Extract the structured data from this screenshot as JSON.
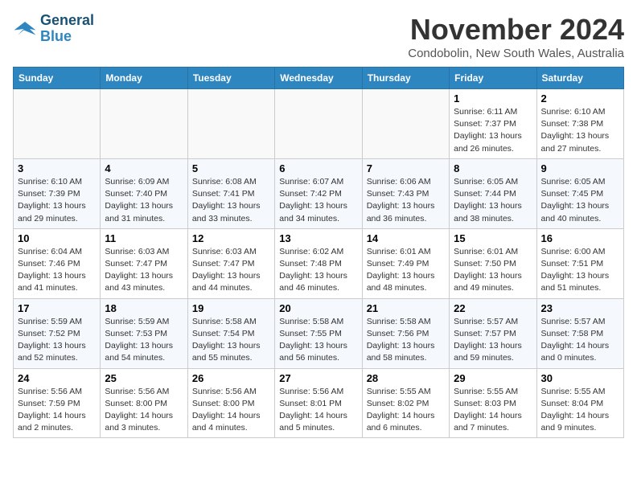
{
  "logo": {
    "line1": "General",
    "line2": "Blue"
  },
  "title": "November 2024",
  "subtitle": "Condobolin, New South Wales, Australia",
  "days_header": [
    "Sunday",
    "Monday",
    "Tuesday",
    "Wednesday",
    "Thursday",
    "Friday",
    "Saturday"
  ],
  "weeks": [
    [
      {
        "day": "",
        "info": ""
      },
      {
        "day": "",
        "info": ""
      },
      {
        "day": "",
        "info": ""
      },
      {
        "day": "",
        "info": ""
      },
      {
        "day": "",
        "info": ""
      },
      {
        "day": "1",
        "info": "Sunrise: 6:11 AM\nSunset: 7:37 PM\nDaylight: 13 hours\nand 26 minutes."
      },
      {
        "day": "2",
        "info": "Sunrise: 6:10 AM\nSunset: 7:38 PM\nDaylight: 13 hours\nand 27 minutes."
      }
    ],
    [
      {
        "day": "3",
        "info": "Sunrise: 6:10 AM\nSunset: 7:39 PM\nDaylight: 13 hours\nand 29 minutes."
      },
      {
        "day": "4",
        "info": "Sunrise: 6:09 AM\nSunset: 7:40 PM\nDaylight: 13 hours\nand 31 minutes."
      },
      {
        "day": "5",
        "info": "Sunrise: 6:08 AM\nSunset: 7:41 PM\nDaylight: 13 hours\nand 33 minutes."
      },
      {
        "day": "6",
        "info": "Sunrise: 6:07 AM\nSunset: 7:42 PM\nDaylight: 13 hours\nand 34 minutes."
      },
      {
        "day": "7",
        "info": "Sunrise: 6:06 AM\nSunset: 7:43 PM\nDaylight: 13 hours\nand 36 minutes."
      },
      {
        "day": "8",
        "info": "Sunrise: 6:05 AM\nSunset: 7:44 PM\nDaylight: 13 hours\nand 38 minutes."
      },
      {
        "day": "9",
        "info": "Sunrise: 6:05 AM\nSunset: 7:45 PM\nDaylight: 13 hours\nand 40 minutes."
      }
    ],
    [
      {
        "day": "10",
        "info": "Sunrise: 6:04 AM\nSunset: 7:46 PM\nDaylight: 13 hours\nand 41 minutes."
      },
      {
        "day": "11",
        "info": "Sunrise: 6:03 AM\nSunset: 7:47 PM\nDaylight: 13 hours\nand 43 minutes."
      },
      {
        "day": "12",
        "info": "Sunrise: 6:03 AM\nSunset: 7:47 PM\nDaylight: 13 hours\nand 44 minutes."
      },
      {
        "day": "13",
        "info": "Sunrise: 6:02 AM\nSunset: 7:48 PM\nDaylight: 13 hours\nand 46 minutes."
      },
      {
        "day": "14",
        "info": "Sunrise: 6:01 AM\nSunset: 7:49 PM\nDaylight: 13 hours\nand 48 minutes."
      },
      {
        "day": "15",
        "info": "Sunrise: 6:01 AM\nSunset: 7:50 PM\nDaylight: 13 hours\nand 49 minutes."
      },
      {
        "day": "16",
        "info": "Sunrise: 6:00 AM\nSunset: 7:51 PM\nDaylight: 13 hours\nand 51 minutes."
      }
    ],
    [
      {
        "day": "17",
        "info": "Sunrise: 5:59 AM\nSunset: 7:52 PM\nDaylight: 13 hours\nand 52 minutes."
      },
      {
        "day": "18",
        "info": "Sunrise: 5:59 AM\nSunset: 7:53 PM\nDaylight: 13 hours\nand 54 minutes."
      },
      {
        "day": "19",
        "info": "Sunrise: 5:58 AM\nSunset: 7:54 PM\nDaylight: 13 hours\nand 55 minutes."
      },
      {
        "day": "20",
        "info": "Sunrise: 5:58 AM\nSunset: 7:55 PM\nDaylight: 13 hours\nand 56 minutes."
      },
      {
        "day": "21",
        "info": "Sunrise: 5:58 AM\nSunset: 7:56 PM\nDaylight: 13 hours\nand 58 minutes."
      },
      {
        "day": "22",
        "info": "Sunrise: 5:57 AM\nSunset: 7:57 PM\nDaylight: 13 hours\nand 59 minutes."
      },
      {
        "day": "23",
        "info": "Sunrise: 5:57 AM\nSunset: 7:58 PM\nDaylight: 14 hours\nand 0 minutes."
      }
    ],
    [
      {
        "day": "24",
        "info": "Sunrise: 5:56 AM\nSunset: 7:59 PM\nDaylight: 14 hours\nand 2 minutes."
      },
      {
        "day": "25",
        "info": "Sunrise: 5:56 AM\nSunset: 8:00 PM\nDaylight: 14 hours\nand 3 minutes."
      },
      {
        "day": "26",
        "info": "Sunrise: 5:56 AM\nSunset: 8:00 PM\nDaylight: 14 hours\nand 4 minutes."
      },
      {
        "day": "27",
        "info": "Sunrise: 5:56 AM\nSunset: 8:01 PM\nDaylight: 14 hours\nand 5 minutes."
      },
      {
        "day": "28",
        "info": "Sunrise: 5:55 AM\nSunset: 8:02 PM\nDaylight: 14 hours\nand 6 minutes."
      },
      {
        "day": "29",
        "info": "Sunrise: 5:55 AM\nSunset: 8:03 PM\nDaylight: 14 hours\nand 7 minutes."
      },
      {
        "day": "30",
        "info": "Sunrise: 5:55 AM\nSunset: 8:04 PM\nDaylight: 14 hours\nand 9 minutes."
      }
    ]
  ]
}
